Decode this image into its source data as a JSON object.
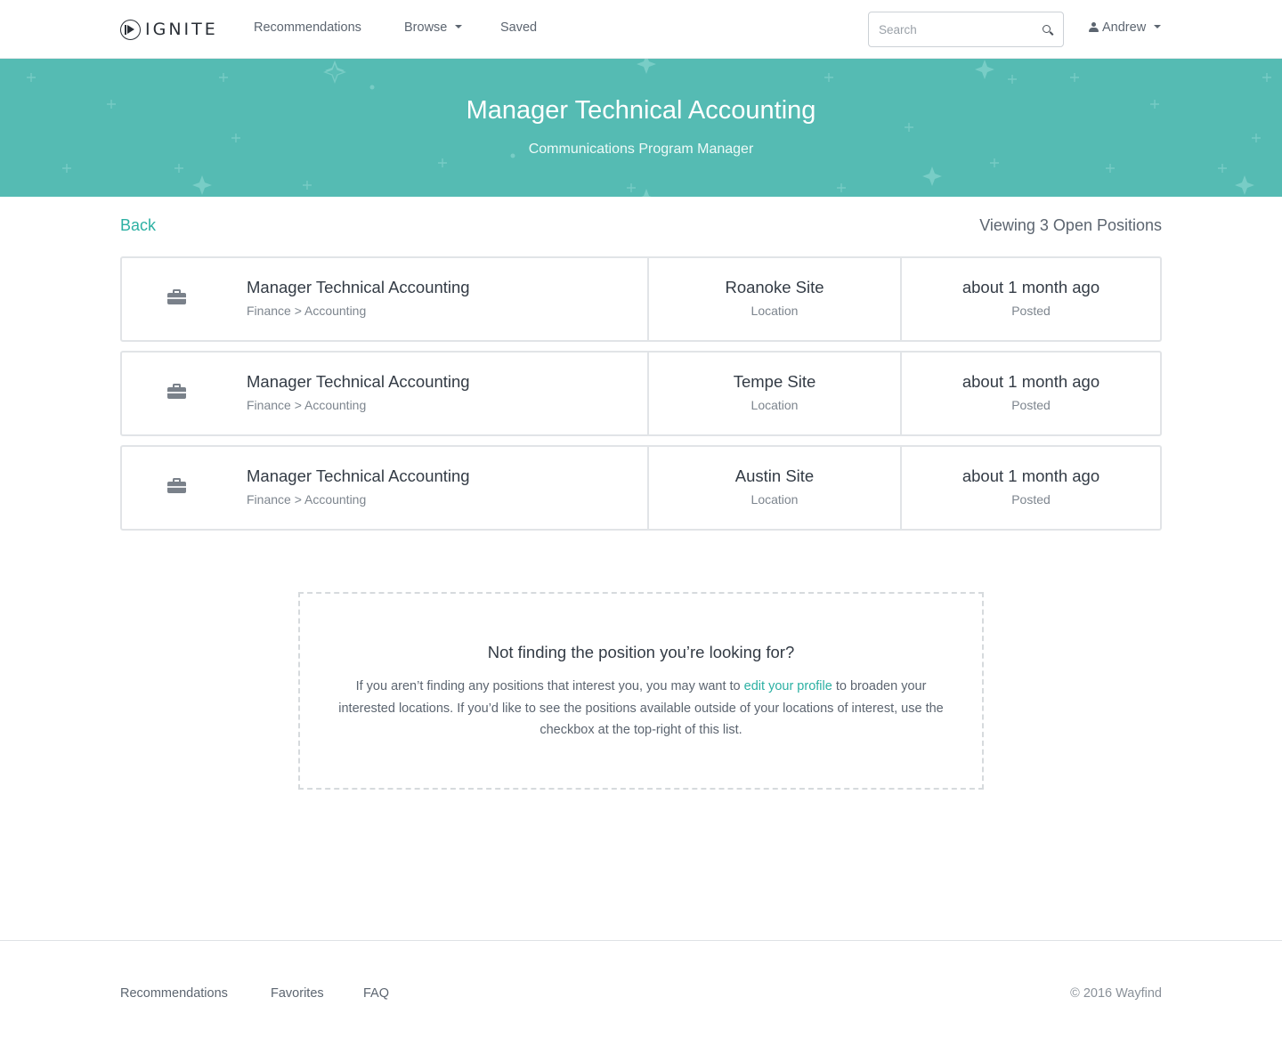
{
  "header": {
    "logo_text": "IGNITE",
    "nav": {
      "recommendations": "Recommendations",
      "browse": "Browse",
      "saved": "Saved"
    },
    "search_placeholder": "Search",
    "user_name": "Andrew"
  },
  "hero": {
    "title": "Manager Technical Accounting",
    "subtitle": "Communications Program Manager",
    "background_color": "#55bbb3"
  },
  "subbar": {
    "back_label": "Back",
    "viewing_label": "Viewing 3 Open Positions"
  },
  "positions": [
    {
      "title": "Manager Technical Accounting",
      "category": "Finance > Accounting",
      "location": "Roanoke Site",
      "location_label": "Location",
      "posted": "about 1 month ago",
      "posted_label": "Posted",
      "icon": "briefcase-icon"
    },
    {
      "title": "Manager Technical Accounting",
      "category": "Finance > Accounting",
      "location": "Tempe Site",
      "location_label": "Location",
      "posted": "about 1 month ago",
      "posted_label": "Posted",
      "icon": "briefcase-icon"
    },
    {
      "title": "Manager Technical Accounting",
      "category": "Finance > Accounting",
      "location": "Austin Site",
      "location_label": "Location",
      "posted": "about 1 month ago",
      "posted_label": "Posted",
      "icon": "briefcase-icon"
    }
  ],
  "help": {
    "title": "Not finding the position you’re looking for?",
    "text_before": "If you aren’t finding any positions that interest you, you may want to ",
    "link_text": "edit your profile",
    "text_after": " to broaden your interested locations. If you’d like to see the positions available outside of your locations of interest, use the checkbox at the top-right of this list."
  },
  "footer": {
    "links": [
      "Recommendations",
      "Favorites",
      "FAQ"
    ],
    "copyright": "© 2016 Wayfind"
  },
  "colors": {
    "accent": "#2cb0a3",
    "hero": "#55bbb3",
    "text": "#333b45",
    "muted": "#7d858e"
  }
}
